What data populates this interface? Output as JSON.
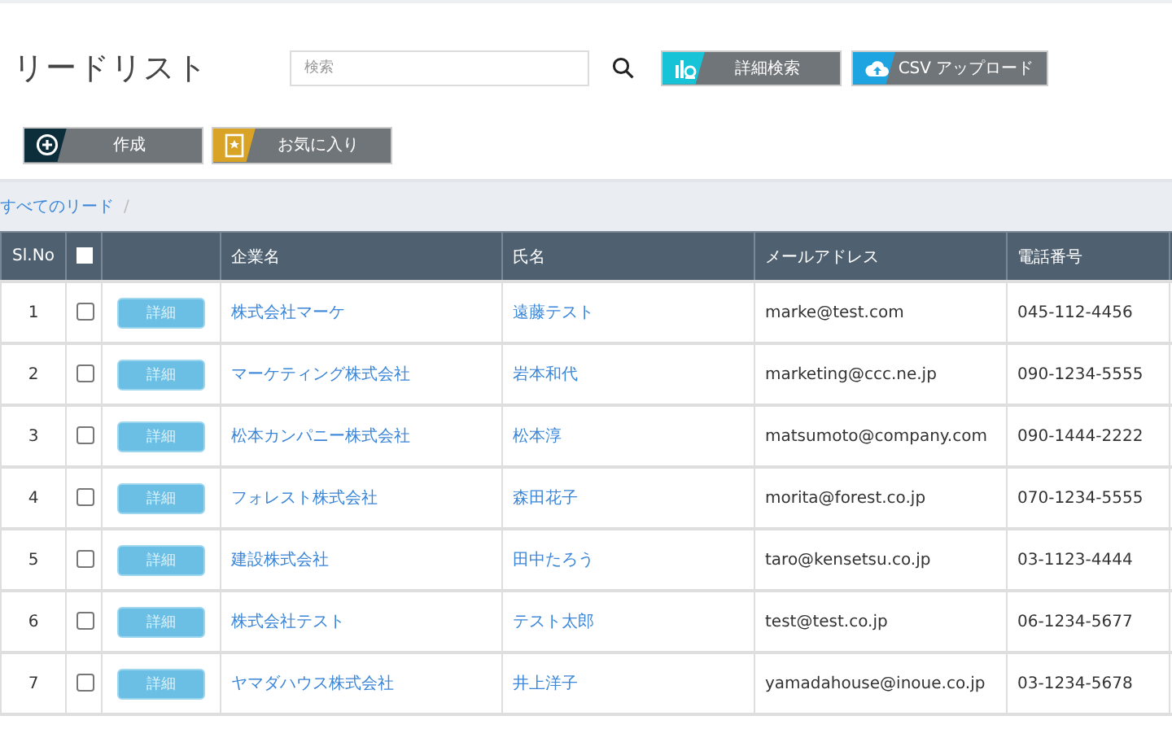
{
  "title": "リードリスト",
  "search": {
    "placeholder": "検索"
  },
  "toolbar_buttons": [
    {
      "kind": "filter",
      "label": "詳細検索",
      "color": "#17c3d6"
    },
    {
      "kind": "upload",
      "label": "CSV アップロード",
      "color": "#1ea4e0"
    }
  ],
  "action_buttons": [
    {
      "kind": "create",
      "label": "作成",
      "color": "#0c2d3a"
    },
    {
      "kind": "favorite",
      "label": "お気に入り",
      "color": "#d9a326"
    }
  ],
  "breadcrumb": {
    "link": "すべてのリード",
    "separator": "/"
  },
  "table": {
    "columns": [
      "Sl.No",
      "",
      "",
      "企業名",
      "氏名",
      "メールアドレス",
      "電話番号"
    ],
    "header_checked": false,
    "rows": [
      {
        "no": "1",
        "checked": false,
        "button": "詳細",
        "company": "株式会社マーケ",
        "name": "遠藤テスト",
        "email": "marke@test.com",
        "phone": "045-112-4456"
      },
      {
        "no": "2",
        "checked": false,
        "button": "詳細",
        "company": "マーケティング株式会社",
        "name": "岩本和代",
        "email": "marketing@ccc.ne.jp",
        "phone": "090-1234-5555"
      },
      {
        "no": "3",
        "checked": false,
        "button": "詳細",
        "company": "松本カンパニー株式会社",
        "name": "松本淳",
        "email": "matsumoto@company.com",
        "phone": "090-1444-2222"
      },
      {
        "no": "4",
        "checked": false,
        "button": "詳細",
        "company": "フォレスト株式会社",
        "name": "森田花子",
        "email": "morita@forest.co.jp",
        "phone": "070-1234-5555"
      },
      {
        "no": "5",
        "checked": false,
        "button": "詳細",
        "company": "建設株式会社",
        "name": "田中たろう",
        "email": "taro@kensetsu.co.jp",
        "phone": "03-1123-4444"
      },
      {
        "no": "6",
        "checked": false,
        "button": "詳細",
        "company": "株式会社テスト",
        "name": "テスト太郎",
        "email": "test@test.co.jp",
        "phone": "06-1234-5677"
      },
      {
        "no": "7",
        "checked": false,
        "button": "詳細",
        "company": "ヤマダハウス株式会社",
        "name": "井上洋子",
        "email": "yamadahouse@inoue.co.jp",
        "phone": "03-1234-5678"
      }
    ]
  }
}
